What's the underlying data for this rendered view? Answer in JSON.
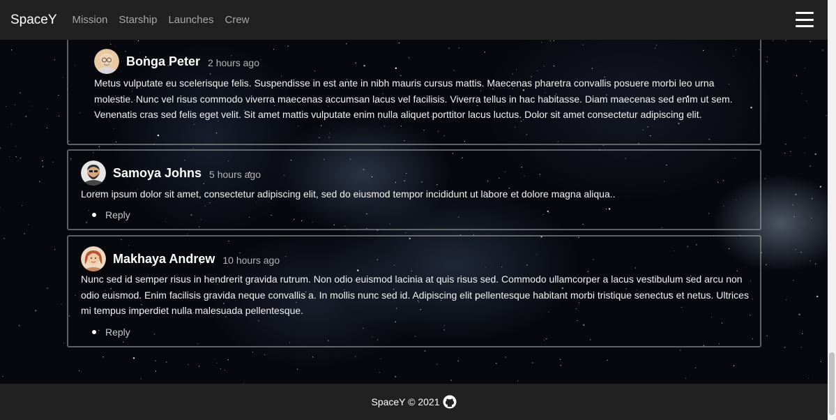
{
  "navbar": {
    "brand": "SpaceY",
    "links": [
      "Mission",
      "Starship",
      "Launches",
      "Crew"
    ],
    "menu_icon": "hamburger-icon"
  },
  "comments": [
    {
      "author": "Bonga Peter",
      "time": "2 hours ago",
      "avatar_icon": "elderly-man-avatar",
      "body": "Metus vulputate eu scelerisque felis. Suspendisse in est ante in nibh mauris cursus mattis. Maecenas pharetra convallis posuere morbi leo urna molestie. Nunc vel risus commodo viverra maecenas accumsan lacus vel facilisis. Viverra tellus in hac habitasse. Diam maecenas sed enim ut sem. Venenatis cras sed felis eget velit. Sit amet mattis vulputate enim nulla aliquet porttitor lacus luctus. Dolor sit amet consectetur adipiscing elit."
    },
    {
      "author": "Samoya Johns",
      "time": "5 hours ago",
      "avatar_icon": "bearded-man-avatar",
      "body": "Lorem ipsum dolor sit amet, consectetur adipiscing elit, sed do eiusmod tempor incididunt ut labore et dolore magna aliqua..",
      "reply": "Reply"
    },
    {
      "author": "Makhaya Andrew",
      "time": "10 hours ago",
      "avatar_icon": "woman-avatar",
      "body": "Nunc sed id semper risus in hendrerit gravida rutrum. Non odio euismod lacinia at quis risus sed. Commodo ullamcorper a lacus vestibulum sed arcu non odio euismod. Enim facilisis gravida neque convallis a. In mollis nunc sed id. Adipiscing elit pellentesque habitant morbi tristique senectus et netus. Ultrices mi tempus imperdiet nulla malesuada pellentesque.",
      "reply": "Reply"
    }
  ],
  "footer": {
    "text": "SpaceY © 2021",
    "icon": "github-icon"
  },
  "colors": {
    "nav_bg": "#212121",
    "nav_link": "#a8a8a8",
    "time_text": "#b5b5b5"
  }
}
